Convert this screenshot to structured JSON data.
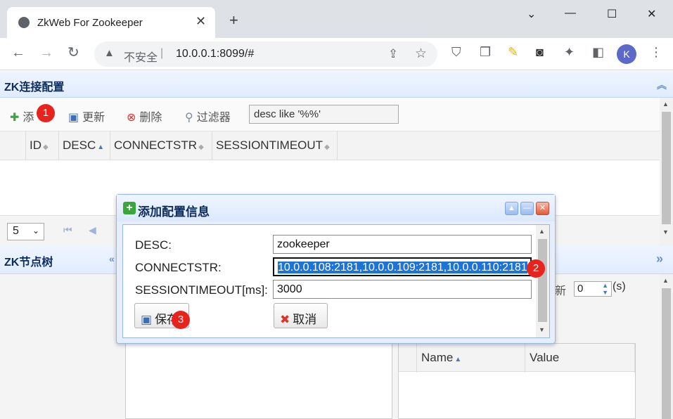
{
  "browser": {
    "tab_title": "ZkWeb For Zookeeper",
    "security_label": "不安全",
    "url": "10.0.0.1:8099/#",
    "profile_initial": "K"
  },
  "zk_config": {
    "panel_title": "ZK连接配置",
    "toolbar": {
      "add_label": "添",
      "update_label": "更新",
      "delete_label": "删除",
      "filter_label": "过滤器",
      "filter_value": "desc like '%%'"
    },
    "columns": [
      "ID",
      "DESC",
      "CONNECTSTR",
      "SESSIONTIMEOUT"
    ],
    "pager": {
      "page_size": "5"
    }
  },
  "zk_tree": {
    "panel_title": "ZK节点树"
  },
  "refresh": {
    "label_fragment": "新",
    "interval_value": "0",
    "unit": "(s)"
  },
  "property_grid": {
    "columns": [
      "Name",
      "Value"
    ]
  },
  "dialog": {
    "title": "添加配置信息",
    "fields": {
      "desc_label": "DESC:",
      "desc_value": "zookeeper",
      "connectstr_label": "CONNECTSTR:",
      "connectstr_value": "10.0.0.108:2181,10.0.0.109:2181,10.0.0.110:2181",
      "timeout_label": "SESSIONTIMEOUT[ms]:",
      "timeout_value": "3000"
    },
    "save_label": "保存",
    "cancel_label": "取消"
  },
  "annotations": [
    "1",
    "2",
    "3"
  ],
  "colors": {
    "accent": "#0e2d5f",
    "panel_header": "#e0ecff",
    "badge": "#e8231e",
    "selection": "#1e73d6"
  }
}
